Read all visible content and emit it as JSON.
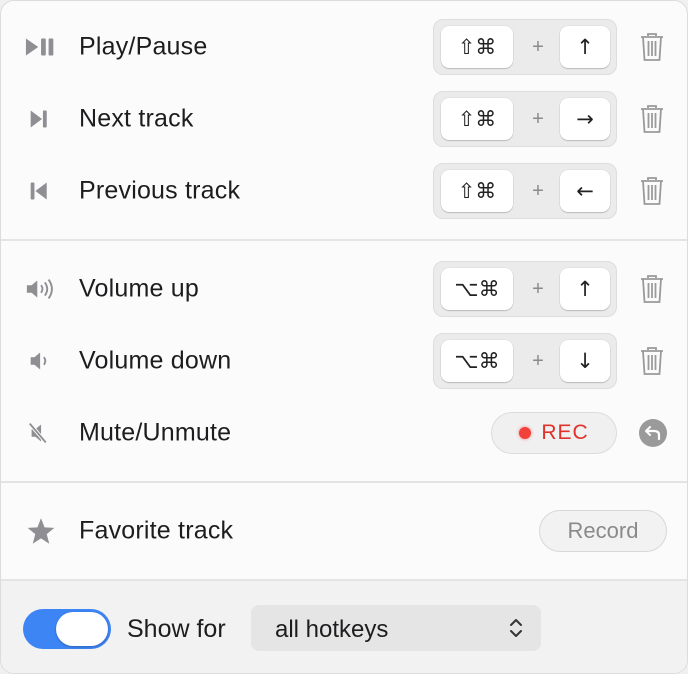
{
  "rows": [
    {
      "label": "Play/Pause",
      "icon": "play-pause-icon",
      "modifiers": "⇧⌘",
      "plus": "+",
      "key": "↑"
    },
    {
      "label": "Next track",
      "icon": "next-track-icon",
      "modifiers": "⇧⌘",
      "plus": "+",
      "key": "→"
    },
    {
      "label": "Previous track",
      "icon": "previous-track-icon",
      "modifiers": "⇧⌘",
      "plus": "+",
      "key": "←"
    },
    {
      "label": "Volume up",
      "icon": "volume-up-icon",
      "modifiers": "⌥⌘",
      "plus": "+",
      "key": "↑"
    },
    {
      "label": "Volume down",
      "icon": "volume-down-icon",
      "modifiers": "⌥⌘",
      "plus": "+",
      "key": "↓"
    },
    {
      "label": "Mute/Unmute",
      "icon": "mute-icon",
      "rec_label": "REC"
    },
    {
      "label": "Favorite track",
      "icon": "star-icon",
      "record_label": "Record"
    }
  ],
  "footer": {
    "toggle_on": true,
    "show_for_label": "Show for",
    "select_value": "all hotkeys"
  },
  "colors": {
    "accent": "#3d84f5",
    "rec": "#e0312b",
    "icon_gray": "#8e8e93"
  }
}
